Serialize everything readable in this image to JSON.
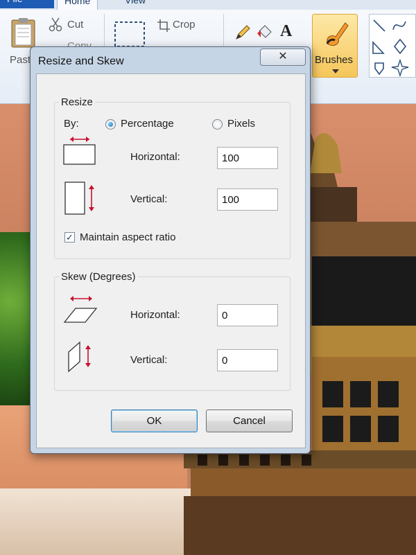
{
  "ribbon": {
    "tabs": [
      "File",
      "Home",
      "View"
    ],
    "clipboard": {
      "paste_label": "Paste",
      "cut_label": "Cut",
      "copy_label": "Copy"
    },
    "image": {
      "crop_label": "Crop"
    },
    "brushes_label": "Brushes"
  },
  "dialog": {
    "title": "Resize and Skew",
    "close_glyph": "✕",
    "resize": {
      "title": "Resize",
      "by_label": "By:",
      "percentage_label": "Percentage",
      "pixels_label": "Pixels",
      "selected_unit": "Percentage",
      "horizontal_label": "Horizontal:",
      "horizontal_value": "100",
      "vertical_label": "Vertical:",
      "vertical_value": "100",
      "maintain_label": "Maintain aspect ratio",
      "maintain_checked": true
    },
    "skew": {
      "title": "Skew (Degrees)",
      "horizontal_label": "Horizontal:",
      "horizontal_value": "0",
      "vertical_label": "Vertical:",
      "vertical_value": "0"
    },
    "ok_label": "OK",
    "cancel_label": "Cancel"
  },
  "colors": {
    "arrow_red": "#c8102e",
    "dialog_frame": "#c6d5e6",
    "client_bg": "#f0f0f0",
    "accent": "#1e5bb4"
  }
}
